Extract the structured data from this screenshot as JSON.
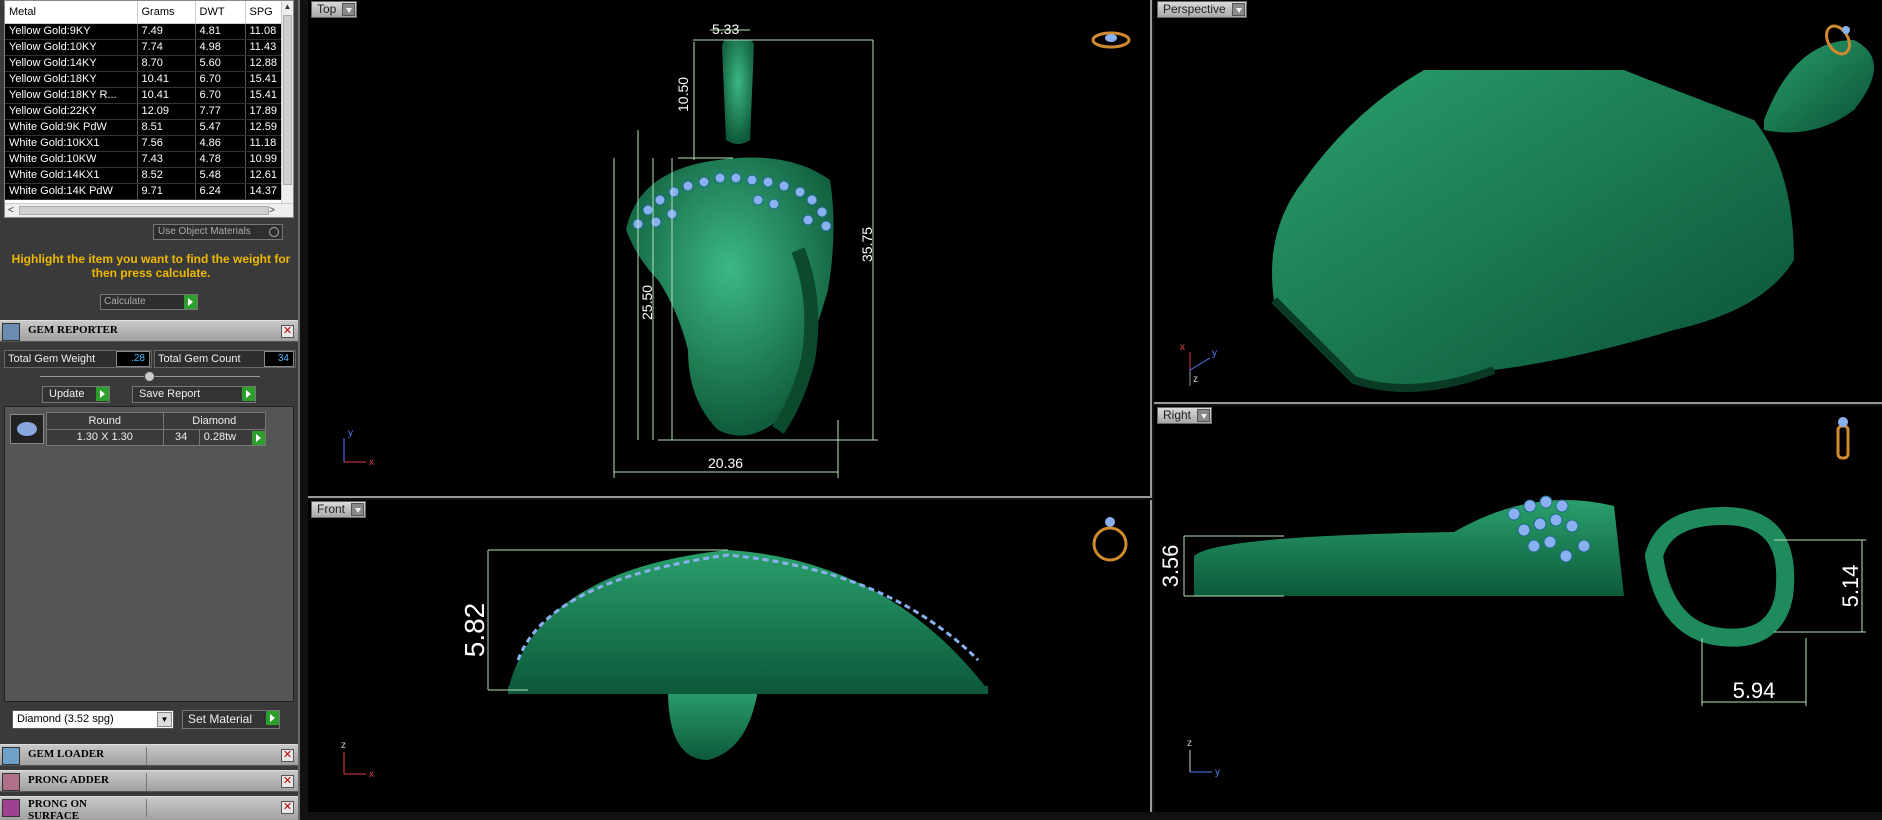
{
  "metal_table": {
    "columns": [
      "Metal",
      "Grams",
      "DWT",
      "SPG"
    ],
    "rows": [
      [
        "Yellow Gold:9KY",
        "7.49",
        "4.81",
        "11.08"
      ],
      [
        "Yellow Gold:10KY",
        "7.74",
        "4.98",
        "11.43"
      ],
      [
        "Yellow Gold:14KY",
        "8.70",
        "5.60",
        "12.88"
      ],
      [
        "Yellow Gold:18KY",
        "10.41",
        "6.70",
        "15.41"
      ],
      [
        "Yellow Gold:18KY R...",
        "10.41",
        "6.70",
        "15.41"
      ],
      [
        "Yellow Gold:22KY",
        "12.09",
        "7.77",
        "17.89"
      ],
      [
        "White Gold:9K PdW",
        "8.51",
        "5.47",
        "12.59"
      ],
      [
        "White Gold:10KX1",
        "7.56",
        "4.86",
        "11.18"
      ],
      [
        "White Gold:10KW",
        "7.43",
        "4.78",
        "10.99"
      ],
      [
        "White Gold:14KX1",
        "8.52",
        "5.48",
        "12.61"
      ],
      [
        "White Gold:14K PdW",
        "9.71",
        "6.24",
        "14.37"
      ]
    ]
  },
  "use_object_materials": "Use Object Materials",
  "instruction": "Highlight the item you want to find the weight for then press calculate.",
  "calculate_label": "Calculate",
  "gem_reporter": {
    "title": "GEM REPORTER",
    "total_weight_label": "Total Gem Weight",
    "total_weight_value": ".28",
    "total_count_label": "Total Gem Count",
    "total_count_value": "34",
    "update_label": "Update",
    "save_label": "Save Report",
    "gems": [
      {
        "shape": "Round",
        "material": "Diamond",
        "size": "1.30 X 1.30",
        "count": "34",
        "weight": "0.28tw"
      }
    ]
  },
  "material_select": "Diamond     (3.52 spg)",
  "set_material_label": "Set Material",
  "panels": {
    "gem_loader": "GEM LOADER",
    "prong_adder": "PRONG ADDER",
    "prong_on_surface": "PRONG ON SURFACE"
  },
  "viewports": {
    "top": {
      "label": "Top",
      "dims": [
        "5.33",
        "10.50",
        "25.50",
        "35.75",
        "20.36"
      ],
      "axes": [
        "y",
        "x"
      ]
    },
    "perspective": {
      "label": "Perspective",
      "axes": [
        "x",
        "y",
        "z"
      ]
    },
    "front": {
      "label": "Front",
      "dims": [
        "5.82"
      ],
      "axes": [
        "z",
        "x"
      ]
    },
    "right": {
      "label": "Right",
      "dims": [
        "3.56",
        "5.14",
        "5.94"
      ],
      "axes": [
        "z",
        "y"
      ]
    }
  },
  "colors": {
    "model_green": "#1c8a5c",
    "gem_blue": "#8ab0f0",
    "highlight_yellow": "#f0b800",
    "value_blue": "#4ab4ff"
  }
}
